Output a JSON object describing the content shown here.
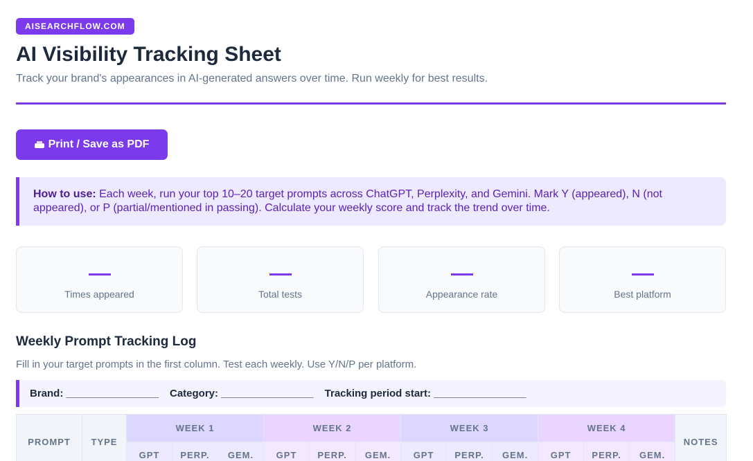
{
  "header": {
    "badge": "AISEARCHFLOW.COM",
    "title": "AI Visibility Tracking Sheet",
    "subtitle": "Track your brand's appearances in AI-generated answers over time. Run weekly for best results."
  },
  "print_button": {
    "label": "Print / Save as PDF",
    "icon": "printer-icon"
  },
  "howto": {
    "label": "How to use:",
    "text": " Each week, run your top 10–20 target prompts across ChatGPT, Perplexity, and Gemini. Mark Y (appeared), N (not appeared), or P (partial/mentioned in passing). Calculate your weekly score and track the trend over time."
  },
  "stats": [
    {
      "value": "—",
      "label": "Times appeared"
    },
    {
      "value": "—",
      "label": "Total tests"
    },
    {
      "value": "—",
      "label": "Appearance rate"
    },
    {
      "value": "—",
      "label": "Best platform"
    }
  ],
  "log": {
    "title": "Weekly Prompt Tracking Log",
    "subtitle": "Fill in your target prompts in the first column. Test each weekly. Use Y/N/P per platform.",
    "meta": {
      "brand": "Brand: ________________",
      "category": "Category: ________________",
      "period": "Tracking period start: ________________"
    },
    "columns": {
      "prompt": "PROMPT",
      "type": "TYPE",
      "weeks": [
        "WEEK 1",
        "WEEK 2",
        "WEEK 3",
        "WEEK 4"
      ],
      "notes": "NOTES",
      "platforms": [
        "GPT",
        "PERP.",
        "GEM."
      ]
    }
  },
  "colors": {
    "accent": "#7c3aed",
    "howto_bg": "#ede9fe",
    "text": "#1e293b",
    "muted": "#64748b"
  }
}
